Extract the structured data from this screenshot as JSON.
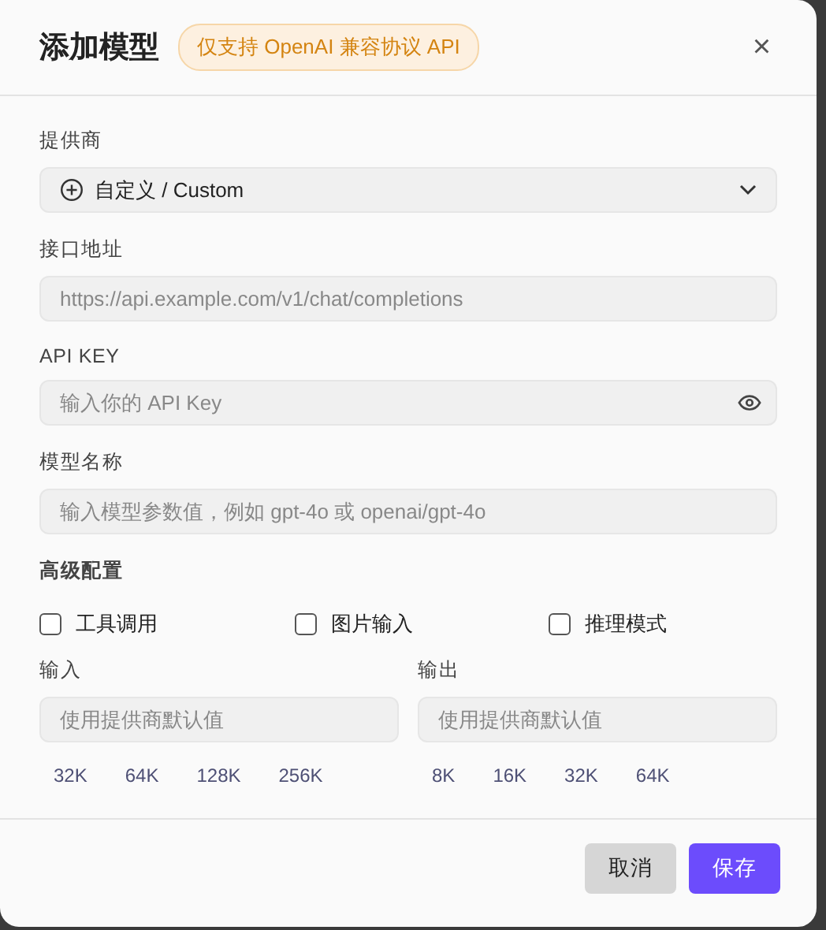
{
  "dialog": {
    "title": "添加模型",
    "badge": "仅支持 OpenAI 兼容协议 API",
    "close": "×"
  },
  "provider": {
    "label": "提供商",
    "value": "自定义 / Custom"
  },
  "endpoint": {
    "label": "接口地址",
    "placeholder": "https://api.example.com/v1/chat/completions"
  },
  "api_key": {
    "label": "API KEY",
    "placeholder": "输入你的 API Key"
  },
  "model_name": {
    "label": "模型名称",
    "placeholder": "输入模型参数值，例如 gpt-4o 或 openai/gpt-4o"
  },
  "advanced": {
    "title": "高级配置",
    "options": [
      {
        "label": "工具调用",
        "checked": false
      },
      {
        "label": "图片输入",
        "checked": false
      },
      {
        "label": "推理模式",
        "checked": false
      }
    ]
  },
  "limits": [
    {
      "label": "输入",
      "placeholder": "使用提供商默认值",
      "presets": [
        "32K",
        "64K",
        "128K",
        "256K"
      ]
    },
    {
      "label": "输出",
      "placeholder": "使用提供商默认值",
      "presets": [
        "8K",
        "16K",
        "32K",
        "64K"
      ]
    }
  ],
  "buttons": [
    {
      "label": "取消",
      "kind": "secondary"
    },
    {
      "label": "保存",
      "kind": "primary"
    }
  ]
}
